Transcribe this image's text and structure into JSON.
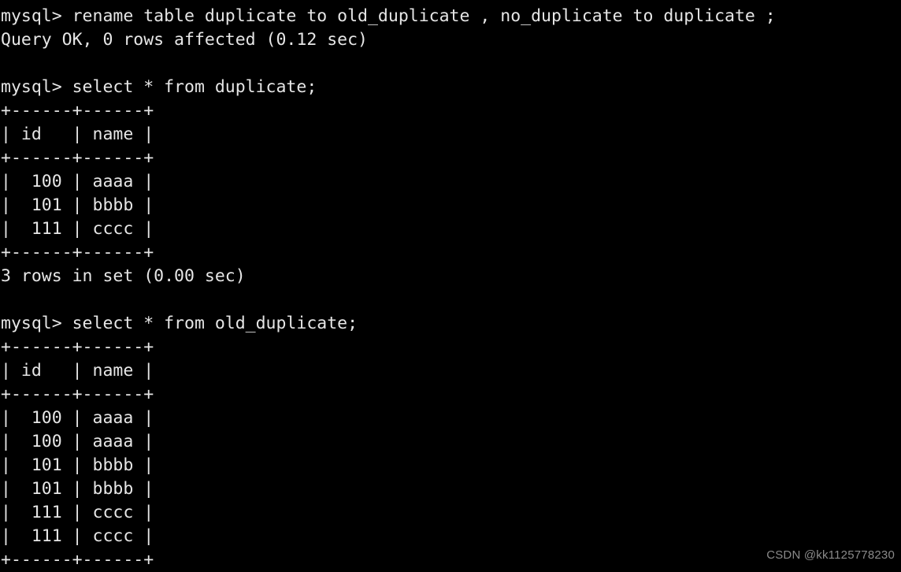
{
  "terminal": {
    "background_color": "#000000",
    "text_color": "#e6e6e6",
    "lines": [
      "mysql> rename table duplicate to old_duplicate , no_duplicate to duplicate ;",
      "Query OK, 0 rows affected (0.12 sec)",
      "",
      "mysql> select * from duplicate;",
      "+------+------+",
      "| id   | name |",
      "+------+------+",
      "|  100 | aaaa |",
      "|  101 | bbbb |",
      "|  111 | cccc |",
      "+------+------+",
      "3 rows in set (0.00 sec)",
      "",
      "mysql> select * from old_duplicate;",
      "+------+------+",
      "| id   | name |",
      "+------+------+",
      "|  100 | aaaa |",
      "|  100 | aaaa |",
      "|  101 | bbbb |",
      "|  101 | bbbb |",
      "|  111 | cccc |",
      "|  111 | cccc |",
      "+------+------+"
    ],
    "commands": [
      {
        "prompt": "mysql>",
        "command": "rename table duplicate to old_duplicate , no_duplicate to duplicate ;",
        "result_status": "Query OK, 0 rows affected (0.12 sec)"
      },
      {
        "prompt": "mysql>",
        "command": "select * from duplicate;",
        "result_status": "3 rows in set (0.00 sec)"
      },
      {
        "prompt": "mysql>",
        "command": "select * from old_duplicate;",
        "result_status": ""
      }
    ],
    "result_tables": [
      {
        "table_name": "duplicate",
        "columns": [
          "id",
          "name"
        ],
        "rows": [
          [
            "100",
            "aaaa"
          ],
          [
            "101",
            "bbbb"
          ],
          [
            "111",
            "cccc"
          ]
        ],
        "row_count_text": "3 rows in set (0.00 sec)"
      },
      {
        "table_name": "old_duplicate",
        "columns": [
          "id",
          "name"
        ],
        "rows": [
          [
            "100",
            "aaaa"
          ],
          [
            "100",
            "aaaa"
          ],
          [
            "101",
            "bbbb"
          ],
          [
            "101",
            "bbbb"
          ],
          [
            "111",
            "cccc"
          ],
          [
            "111",
            "cccc"
          ]
        ],
        "row_count_text": ""
      }
    ]
  },
  "watermark": {
    "text": "CSDN @kk1125778230",
    "color": "#8a8a8a"
  }
}
